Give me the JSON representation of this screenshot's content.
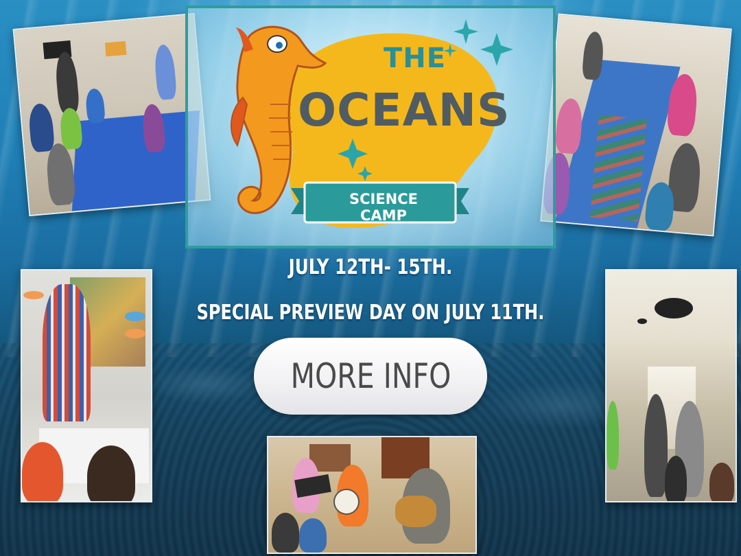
{
  "logo": {
    "line1": "THE",
    "line2": "OCEANS",
    "banner": "SCIENCE CAMP"
  },
  "event": {
    "dates": "JULY 12TH- 15TH.",
    "preview": "SPECIAL PREVIEW DAY ON JULY 11TH."
  },
  "cta": {
    "label": "MORE INFO"
  },
  "colors": {
    "teal": "#2e9d9d",
    "logo_yellow": "#f5b81c",
    "button": "#f2f2f4"
  }
}
